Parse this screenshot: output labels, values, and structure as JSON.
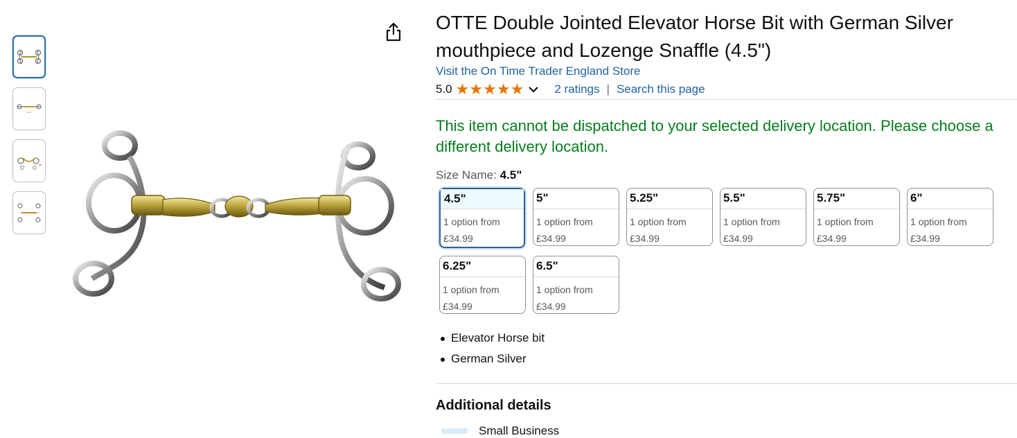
{
  "product": {
    "title": "OTTE Double Jointed Elevator Horse Bit with German Silver mouthpiece and Lozenge Snaffle (4.5\")",
    "store_link": "Visit the On Time Trader England Store",
    "rating_value": "5.0",
    "stars": 5,
    "ratings_link": "2 ratings",
    "separator": "|",
    "search_link": "Search this page"
  },
  "gallery": {
    "selected_index": 0,
    "thumbnails": [
      "bit-front",
      "bit-flat",
      "bit-measured",
      "bit-dimensions"
    ]
  },
  "delivery_message": "This item cannot be dispatched to your selected delivery location. Please choose a different delivery location.",
  "size": {
    "label": "Size Name:",
    "selected": "4.5\"",
    "options": [
      {
        "name": "4.5\"",
        "sub": "1 option from",
        "price": "£34.99",
        "selected": true
      },
      {
        "name": "5\"",
        "sub": "1 option from",
        "price": "£34.99",
        "selected": false
      },
      {
        "name": "5.25\"",
        "sub": "1 option from",
        "price": "£34.99",
        "selected": false
      },
      {
        "name": "5.5\"",
        "sub": "1 option from",
        "price": "£34.99",
        "selected": false
      },
      {
        "name": "5.75\"",
        "sub": "1 option from",
        "price": "£34.99",
        "selected": false
      },
      {
        "name": "6\"",
        "sub": "1 option from",
        "price": "£34.99",
        "selected": false
      },
      {
        "name": "6.25\"",
        "sub": "1 option from",
        "price": "£34.99",
        "selected": false
      },
      {
        "name": "6.5\"",
        "sub": "1 option from",
        "price": "£34.99",
        "selected": false
      }
    ]
  },
  "bullets": [
    "Elevator Horse bit",
    "German Silver"
  ],
  "additional_details": {
    "title": "Additional details",
    "small_business": "Small Business"
  },
  "colors": {
    "link": "#2162a1",
    "success_green": "#067d1d",
    "star": "#e77600",
    "selected_border": "#2f5f8f"
  }
}
